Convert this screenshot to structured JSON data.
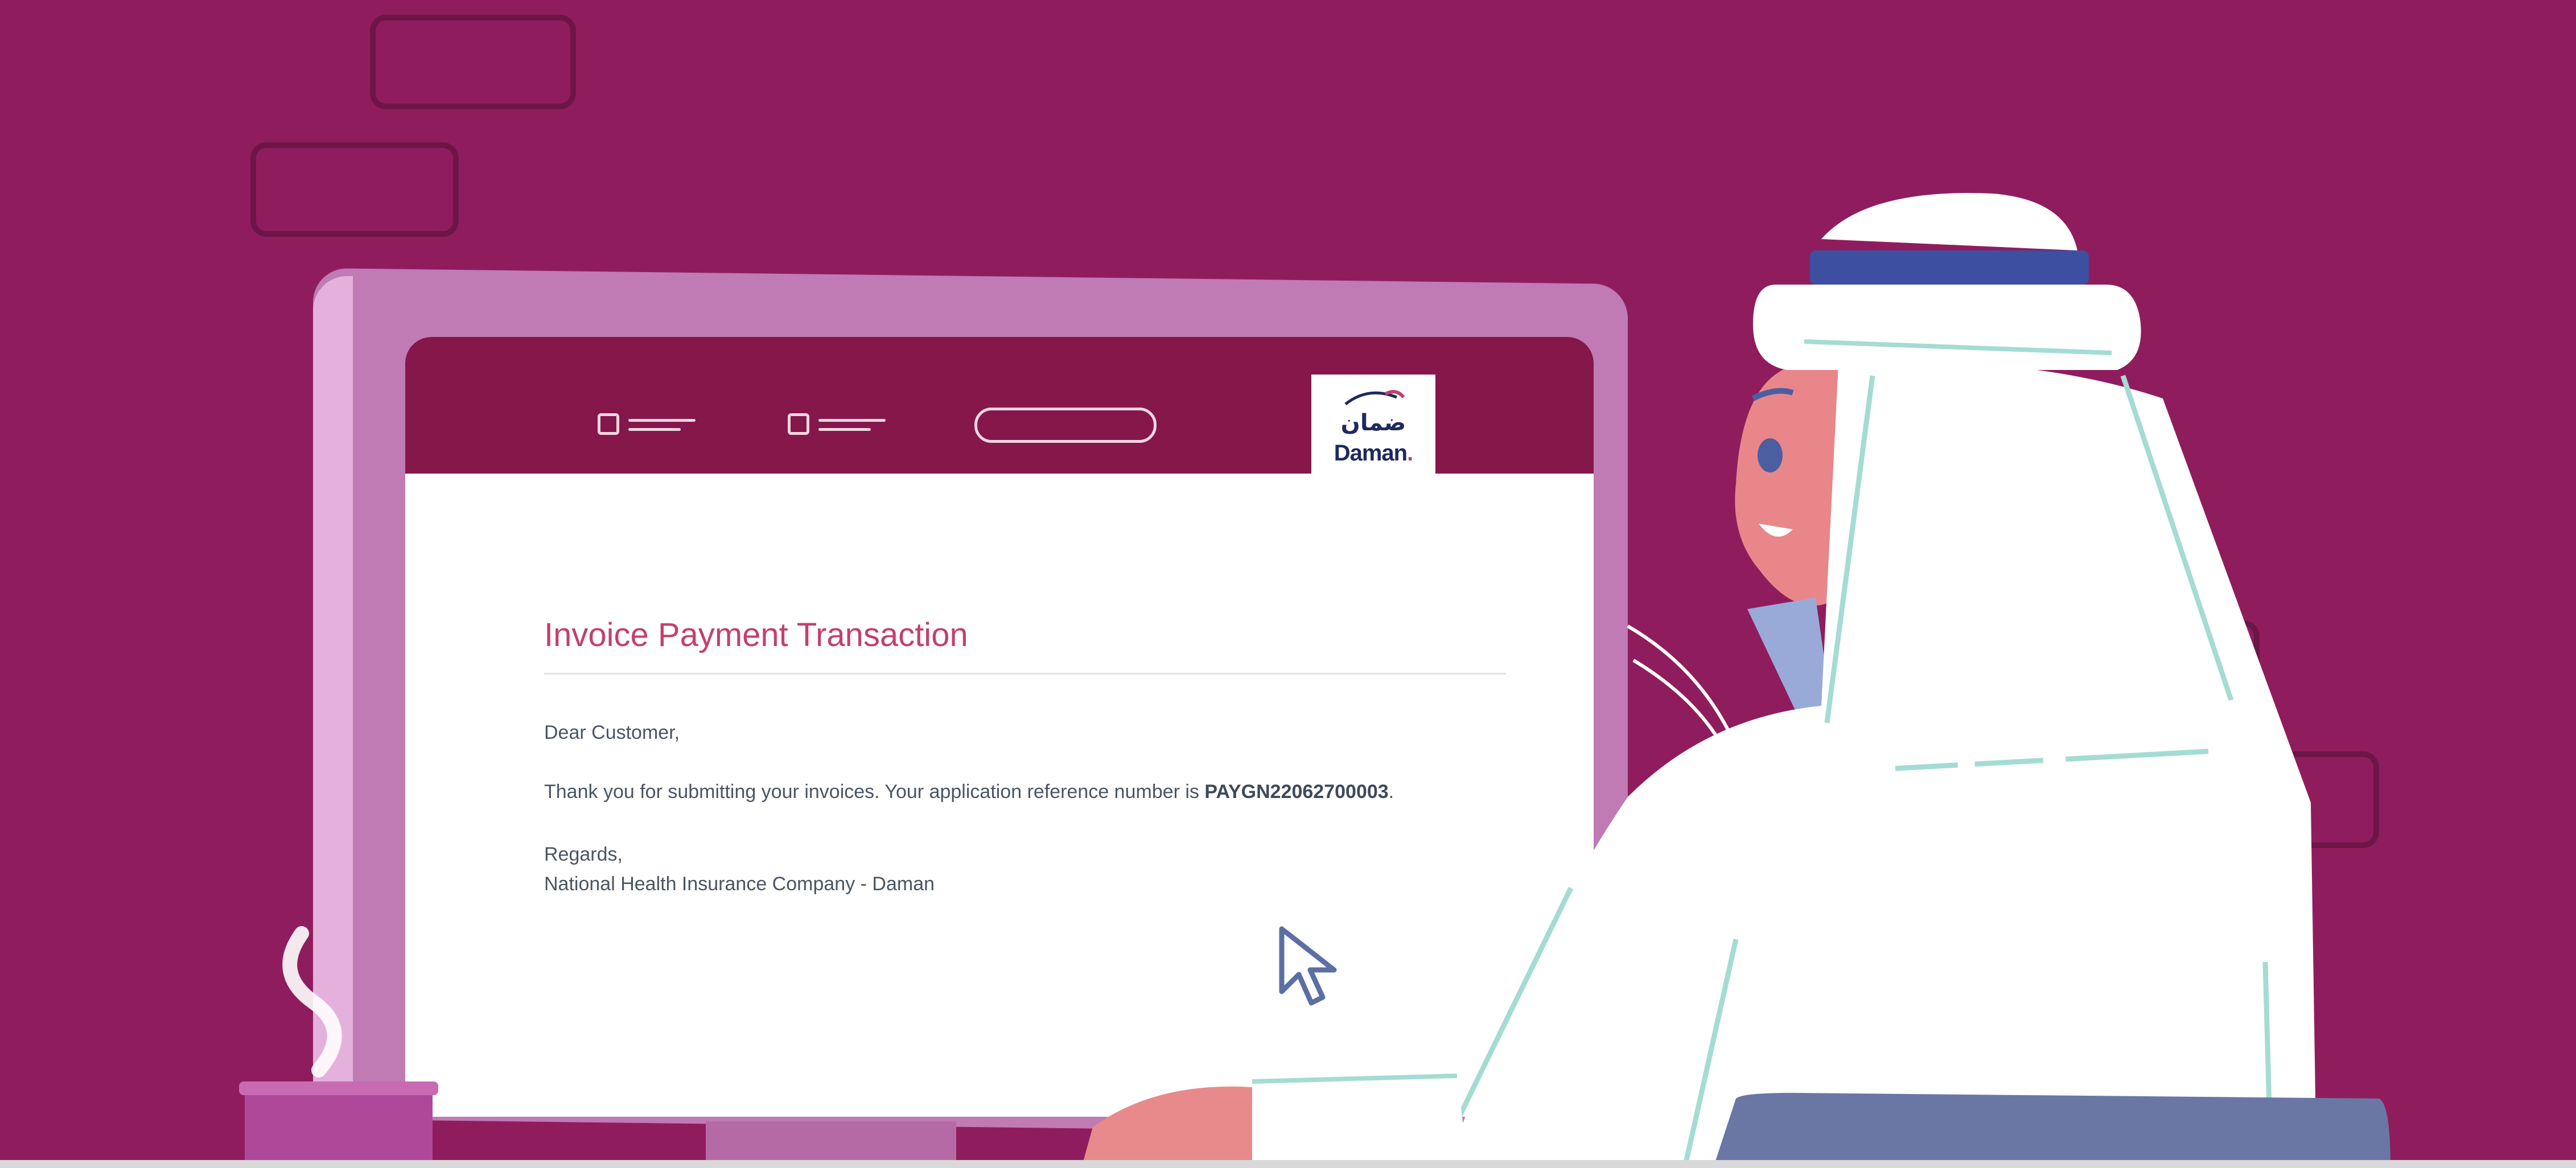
{
  "colors": {
    "background": "#8f1d5e",
    "header": "#85174a",
    "title": "#c2416b",
    "body_text": "#4a5562",
    "logo_navy": "#1e2a5c"
  },
  "header": {
    "nav_items": [
      "",
      ""
    ],
    "logo": {
      "arabic": "ضمان",
      "english": "Daman",
      "icon": "daman-swoosh-icon"
    }
  },
  "content": {
    "title": "Invoice Payment Transaction",
    "greeting": "Dear Customer,",
    "message_prefix": "Thank you for submitting your invoices. Your application reference number is ",
    "reference_number": "PAYGN22062700003",
    "message_suffix": ".",
    "closing": "Regards,",
    "signature": "National Health Insurance Company - Daman"
  },
  "icons": [
    "cursor-arrow-icon",
    "checkbox-icon",
    "steam-icon"
  ]
}
